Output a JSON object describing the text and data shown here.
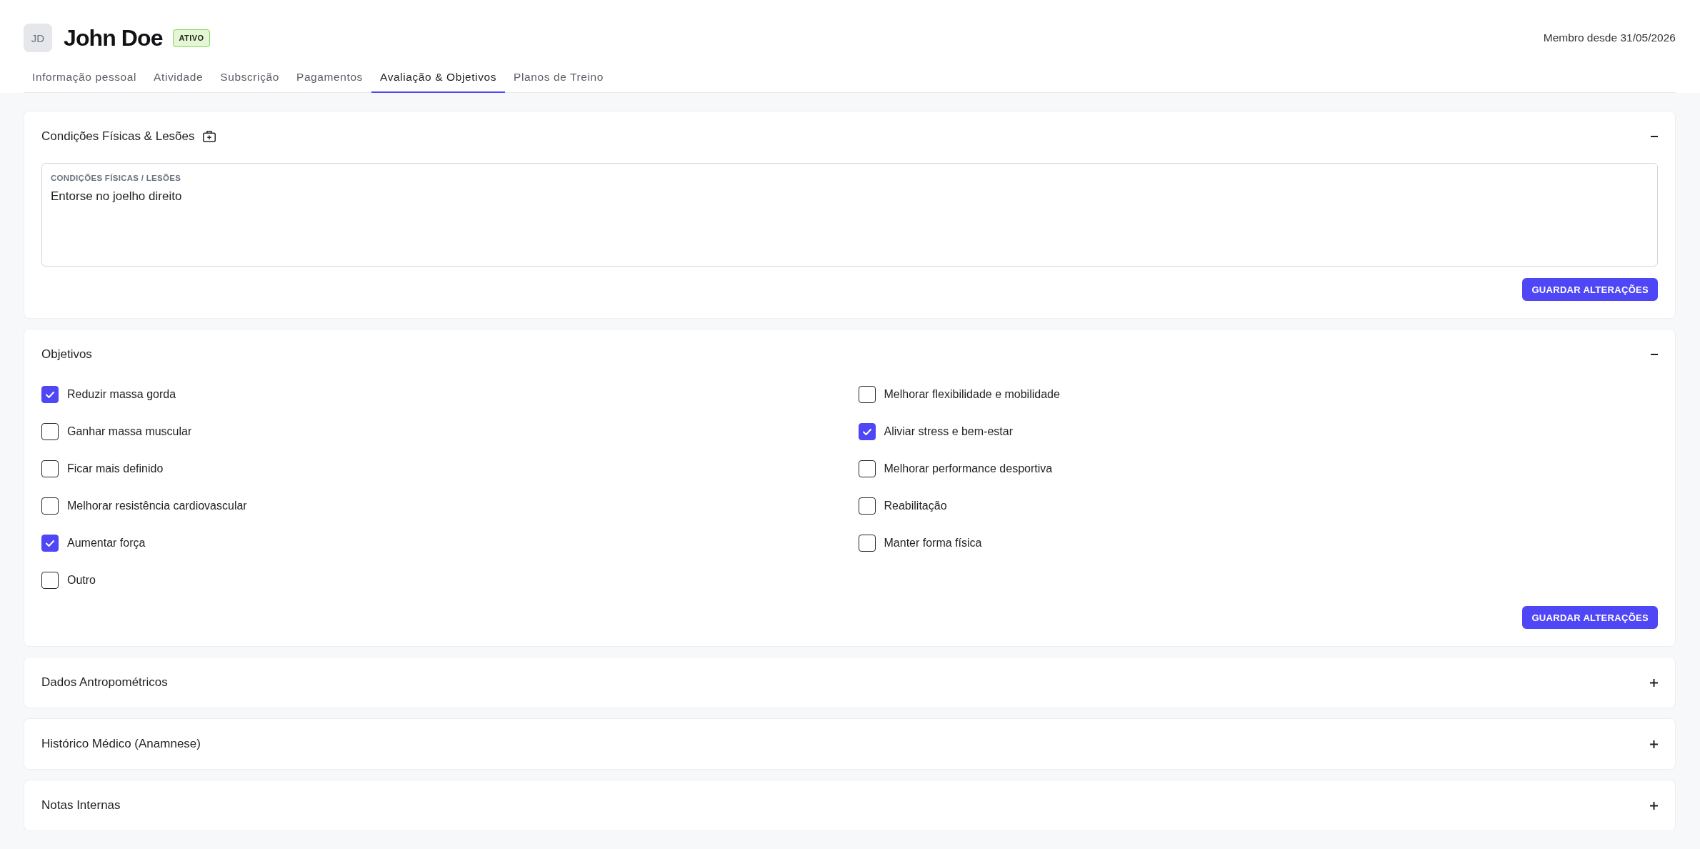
{
  "member": {
    "initials": "JD",
    "name": "John Doe",
    "status": "ATIVO",
    "member_since": "Membro desde 31/05/2026"
  },
  "tabs": [
    {
      "label": "Informação pessoal",
      "selected": false
    },
    {
      "label": "Atividade",
      "selected": false
    },
    {
      "label": "Subscrição",
      "selected": false
    },
    {
      "label": "Pagamentos",
      "selected": false
    },
    {
      "label": "Avaliação & Objetivos",
      "selected": true
    },
    {
      "label": "Planos de Treino",
      "selected": false
    }
  ],
  "sections": [
    {
      "kind": "textarea",
      "title": "Condições Físicas & Lesões",
      "title_icon": true,
      "expanded": true,
      "field": {
        "label": "CONDIÇÕES FÍSICAS / LESÕES",
        "value": "Entorse no joelho direito"
      },
      "button": "GUARDAR ALTERAÇÕES"
    },
    {
      "kind": "checklist",
      "title": "Objetivos",
      "expanded": true,
      "columns": [
        {
          "options": [
            {
              "label": "Reduzir massa gorda",
              "checked": true
            },
            {
              "label": "Ganhar massa muscular",
              "checked": false
            },
            {
              "label": "Ficar mais definido",
              "checked": false
            },
            {
              "label": "Melhorar resistência cardiovascular",
              "checked": false
            },
            {
              "label": "Aumentar força",
              "checked": true
            },
            {
              "label": "Outro",
              "checked": false
            }
          ]
        },
        {
          "options": [
            {
              "label": "Melhorar flexibilidade e mobilidade",
              "checked": false
            },
            {
              "label": "Aliviar stress e bem-estar",
              "checked": true
            },
            {
              "label": "Melhorar performance desportiva",
              "checked": false
            },
            {
              "label": "Reabilitação",
              "checked": false
            },
            {
              "label": "Manter forma física",
              "checked": false
            }
          ]
        }
      ],
      "button": "GUARDAR ALTERAÇÕES"
    },
    {
      "title": "Dados Antropométricos",
      "expanded": false
    },
    {
      "title": "Histórico Médico (Anamnese)",
      "expanded": false
    },
    {
      "title": "Notas Internas",
      "expanded": false
    }
  ]
}
